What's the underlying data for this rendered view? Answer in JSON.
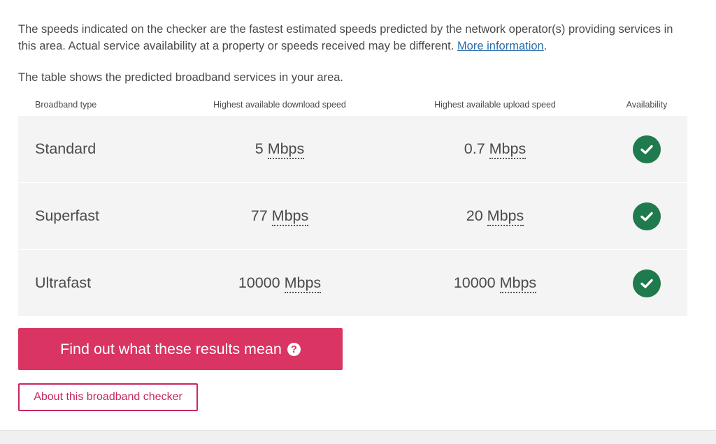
{
  "intro": {
    "text": "The speeds indicated on the checker are the fastest estimated speeds predicted by the network operator(s) providing services in this area. Actual service availability at a property or speeds received may be different. ",
    "link": "More information",
    "suffix": "."
  },
  "table_intro": "The table shows the predicted broadband services in your area.",
  "table": {
    "headers": {
      "type": "Broadband type",
      "download": "Highest available download speed",
      "upload": "Highest available upload speed",
      "availability": "Availability"
    },
    "rows": [
      {
        "type": "Standard",
        "download_value": "5",
        "download_unit": "Mbps",
        "upload_value": "0.7",
        "upload_unit": "Mbps",
        "available": true
      },
      {
        "type": "Superfast",
        "download_value": "77",
        "download_unit": "Mbps",
        "upload_value": "20",
        "upload_unit": "Mbps",
        "available": true
      },
      {
        "type": "Ultrafast",
        "download_value": "10000",
        "download_unit": "Mbps",
        "upload_value": "10000",
        "upload_unit": "Mbps",
        "available": true
      }
    ]
  },
  "buttons": {
    "results": "Find out what these results mean",
    "about": "About this broadband checker"
  },
  "icons": {
    "available": "check-circle-icon",
    "help": "question-circle-icon"
  },
  "colors": {
    "primary": "#d93462",
    "success": "#1f7a4d",
    "link": "#2b6ea8"
  }
}
